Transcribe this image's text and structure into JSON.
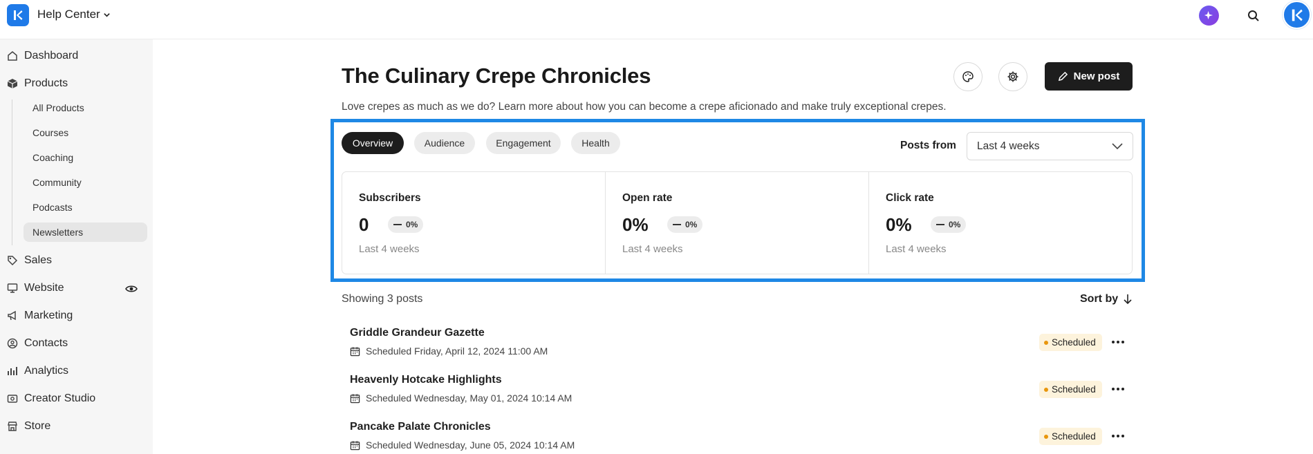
{
  "header": {
    "site_title": "Help Center"
  },
  "sidebar": {
    "items": [
      {
        "label": "Dashboard",
        "icon": "home-icon"
      },
      {
        "label": "Products",
        "icon": "box-icon"
      },
      {
        "label": "Sales",
        "icon": "tag-icon"
      },
      {
        "label": "Website",
        "icon": "monitor-icon"
      },
      {
        "label": "Marketing",
        "icon": "megaphone-icon"
      },
      {
        "label": "Contacts",
        "icon": "person-circle-icon"
      },
      {
        "label": "Analytics",
        "icon": "bar-chart-icon"
      },
      {
        "label": "Creator Studio",
        "icon": "studio-icon"
      },
      {
        "label": "Store",
        "icon": "store-icon"
      }
    ],
    "products_sub": [
      "All Products",
      "Courses",
      "Coaching",
      "Community",
      "Podcasts",
      "Newsletters"
    ],
    "active_sub": "Newsletters"
  },
  "main": {
    "title": "The Culinary Crepe Chronicles",
    "description": "Love crepes as much as we do? Learn more about how you can become a crepe aficionado and make truly exceptional crepes.",
    "new_post_label": "New post",
    "tabs": [
      "Overview",
      "Audience",
      "Engagement",
      "Health"
    ],
    "active_tab": "Overview",
    "posts_from_label": "Posts from",
    "posts_from_value": "Last 4 weeks",
    "stats": [
      {
        "label": "Subscribers",
        "value": "0",
        "change": "0%",
        "period": "Last 4 weeks"
      },
      {
        "label": "Open rate",
        "value": "0%",
        "change": "0%",
        "period": "Last 4 weeks"
      },
      {
        "label": "Click rate",
        "value": "0%",
        "change": "0%",
        "period": "Last 4 weeks"
      }
    ],
    "showing_text": "Showing 3 posts",
    "sort_label": "Sort by",
    "posts": [
      {
        "title": "Griddle Grandeur Gazette",
        "scheduled": "Scheduled Friday, April 12, 2024 11:00 AM",
        "status": "Scheduled"
      },
      {
        "title": "Heavenly Hotcake Highlights",
        "scheduled": "Scheduled Wednesday, May 01, 2024 10:14 AM",
        "status": "Scheduled"
      },
      {
        "title": "Pancake Palate Chronicles",
        "scheduled": "Scheduled Wednesday, June 05, 2024 10:14 AM",
        "status": "Scheduled"
      }
    ]
  },
  "colors": {
    "accent": "#1e88e5",
    "brand": "#1f7ae8",
    "dark_button": "#1d1d1d",
    "badge_bg": "#fdf3dc",
    "badge_dot": "#e8960c"
  }
}
